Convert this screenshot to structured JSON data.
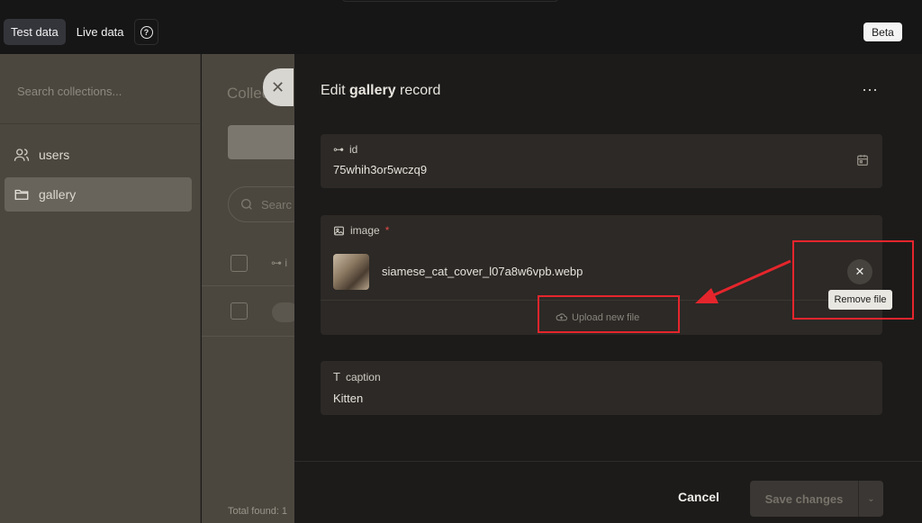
{
  "topbar": {
    "modes": [
      "Test data",
      "Live data"
    ],
    "active_mode": "Test data",
    "help_icon": "question-circle-icon",
    "beta_label": "Beta"
  },
  "sidebar": {
    "search_placeholder": "Search collections...",
    "items": [
      {
        "label": "users",
        "icon": "users-icon"
      },
      {
        "label": "gallery",
        "icon": "folder-icon"
      }
    ],
    "active": "gallery"
  },
  "main": {
    "heading": "Collectio",
    "search_placeholder": "Searc",
    "id_column": "i",
    "total_label": "Total found: 1"
  },
  "panel": {
    "title_prefix": "Edit ",
    "title_collection": "gallery",
    "title_suffix": " record",
    "more_icon": "more-horizontal-icon",
    "fields": {
      "id": {
        "label": "id",
        "value": "75whih3or5wczq9"
      },
      "image": {
        "label": "image",
        "required_mark": "*",
        "filename": "siamese_cat_cover_l07a8w6vpb.webp",
        "upload_label": "Upload new file",
        "remove_tooltip": "Remove file"
      },
      "caption": {
        "label": "caption",
        "value": "Kitten"
      }
    },
    "cancel_label": "Cancel",
    "save_label": "Save changes"
  },
  "colors": {
    "annotation": "#e5252c",
    "panel_bg": "#1c1b1a",
    "field_bg": "#2c2926",
    "required": "#e04a4a"
  }
}
